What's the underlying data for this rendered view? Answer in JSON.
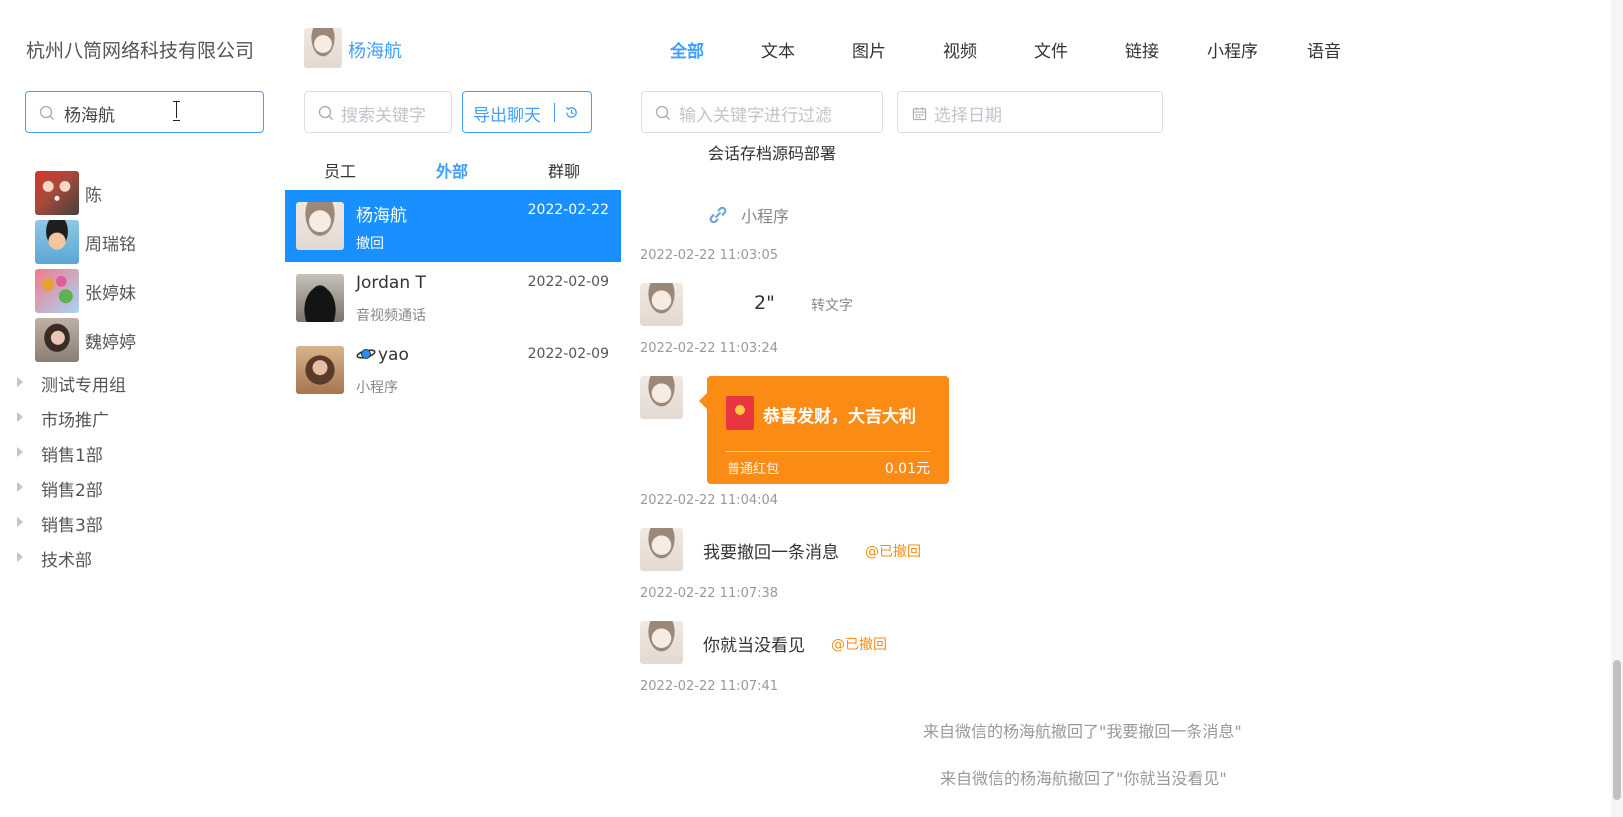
{
  "company": "杭州八筒网络科技有限公司",
  "search": {
    "value": "杨海航"
  },
  "contacts": [
    {
      "name": "陈",
      "avatar": "avatar-chen"
    },
    {
      "name": "周瑞铭",
      "avatar": "avatar-zhou"
    },
    {
      "name": "张婷妹",
      "avatar": "avatar-zhang"
    },
    {
      "name": "魏婷婷",
      "avatar": "avatar-wei"
    }
  ],
  "departments": [
    "测试专用组",
    "市场推广",
    "销售1部",
    "销售2部",
    "销售3部",
    "技术部"
  ],
  "current_user": {
    "name": "杨海航"
  },
  "keyword": {
    "placeholder": "搜索关键字"
  },
  "export_label": "导出聊天",
  "tabs": [
    {
      "label": "员工",
      "active": false
    },
    {
      "label": "外部",
      "active": true
    },
    {
      "label": "群聊",
      "active": false
    }
  ],
  "conversations": [
    {
      "name": "杨海航",
      "subtitle": "撤回",
      "date": "2022-02-22",
      "selected": true
    },
    {
      "name": "Jordan T",
      "subtitle": "音视频通话",
      "date": "2022-02-09",
      "selected": false
    },
    {
      "name": "yao",
      "subtitle": "小程序",
      "date": "2022-02-09",
      "selected": false
    }
  ],
  "type_tabs": [
    {
      "label": "全部",
      "active": true
    },
    {
      "label": "文本",
      "active": false
    },
    {
      "label": "图片",
      "active": false
    },
    {
      "label": "视频",
      "active": false
    },
    {
      "label": "文件",
      "active": false
    },
    {
      "label": "链接",
      "active": false
    },
    {
      "label": "小程序",
      "active": false
    },
    {
      "label": "语音",
      "active": false
    }
  ],
  "filter": {
    "placeholder": "输入关键字进行过滤"
  },
  "date_picker": {
    "placeholder": "选择日期"
  },
  "messages": {
    "mini_title": "会话存档源码部署",
    "mini_label": "小程序",
    "ts1": "2022-02-22 11:03:05",
    "voice_duration": "2\"",
    "transcribe_label": "转文字",
    "ts2": "2022-02-22 11:03:24",
    "red_packet": {
      "wish": "恭喜发财，大吉大利",
      "type": "普通红包",
      "amount": "0.01元"
    },
    "ts3": "2022-02-22 11:04:04",
    "text1": "我要撤回一条消息",
    "recalled_label": "@已撤回",
    "ts4": "2022-02-22 11:07:38",
    "text2": "你就当没看见",
    "ts5": "2022-02-22 11:07:41",
    "notice1": "来自微信的杨海航撤回了\"我要撤回一条消息\"",
    "notice2": "来自微信的杨海航撤回了\"你就当没看见\""
  },
  "colors": {
    "accent": "#409eff",
    "selected_row": "#1890ff",
    "red_packet": "#fa8c16",
    "recalled": "#fa8c16"
  }
}
